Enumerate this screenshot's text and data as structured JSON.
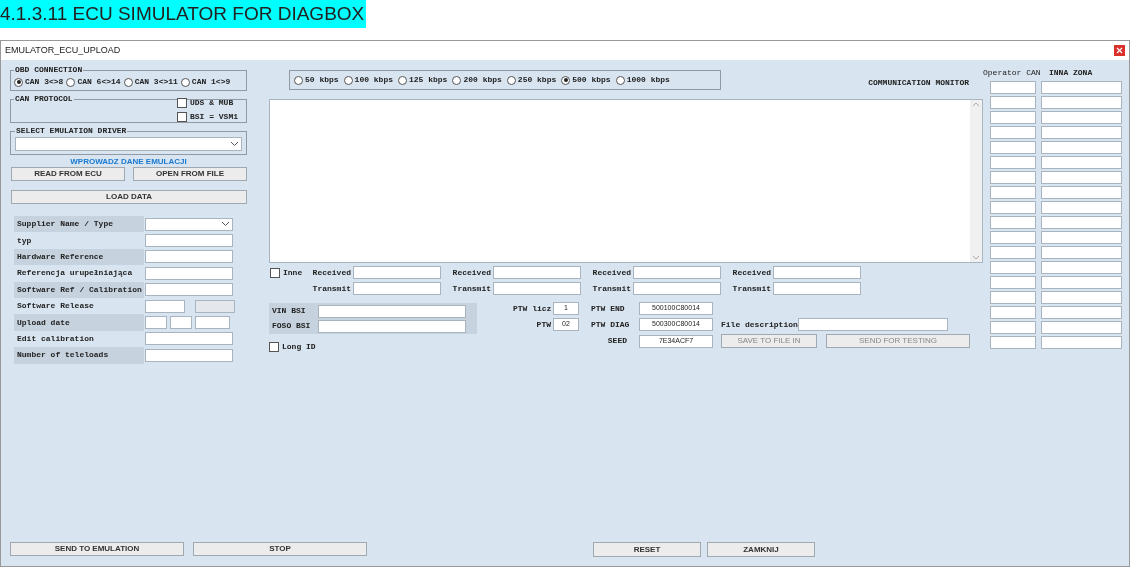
{
  "heading": "4.1.3.11 ECU SIMULATOR FOR DIAGBOX",
  "window": {
    "title": "EMULATOR_ECU_UPLOAD"
  },
  "obd_connection": {
    "legend": "OBD CONNECTION",
    "options": [
      {
        "label": "CAN 3<>8",
        "selected": true
      },
      {
        "label": "CAN 6<>14",
        "selected": false
      },
      {
        "label": "CAN 3<>11",
        "selected": false
      },
      {
        "label": "CAN 1<>9",
        "selected": false
      }
    ]
  },
  "can_protocol": {
    "legend": "CAN PROTOCOL",
    "options": [
      {
        "label": "UDS & MUB",
        "checked": false
      },
      {
        "label": "BSI = VSM1",
        "checked": false
      }
    ]
  },
  "emulation_driver": {
    "legend": "SELECT EMULATION DRIVER"
  },
  "section_title": "WPROWADZ DANE EMULACJI",
  "source_buttons": [
    "READ FROM ECU",
    "OPEN FROM FILE"
  ],
  "load_button": "LOAD DATA",
  "form": [
    {
      "label": "Supplier Name / Type",
      "kind": "select"
    },
    {
      "label": "typ",
      "kind": "text"
    },
    {
      "label": "Hardware Reference",
      "kind": "text"
    },
    {
      "label": "Referencja urupełniająca",
      "kind": "text"
    },
    {
      "label": "Software Ref / Calibration",
      "kind": "text"
    },
    {
      "label": "Software Release",
      "kind": "pair"
    },
    {
      "label": "Upload date",
      "kind": "date"
    },
    {
      "label": "Edit calibration",
      "kind": "text"
    },
    {
      "label": "Number of teleloads",
      "kind": "text"
    }
  ],
  "baud_rates": [
    {
      "label": "50 kbps",
      "selected": false
    },
    {
      "label": "100 kbps",
      "selected": false
    },
    {
      "label": "125 kbps",
      "selected": false
    },
    {
      "label": "200 kbps",
      "selected": false
    },
    {
      "label": "250 kbps",
      "selected": false
    },
    {
      "label": "500 kbps",
      "selected": true
    },
    {
      "label": "1000 kbps",
      "selected": false
    }
  ],
  "monitor": {
    "title": "COMMUNICATION MONITOR"
  },
  "inne": {
    "label": "Inne",
    "checked": false
  },
  "channels": [
    {
      "received": "Received",
      "transmit": "Transmit"
    },
    {
      "received": "Received",
      "transmit": "Transmit"
    },
    {
      "received": "Received",
      "transmit": "Transmit"
    },
    {
      "received": "Received",
      "transmit": "Transmit"
    }
  ],
  "bsi": [
    {
      "label": "VIN BSI"
    },
    {
      "label": "FOSO BSI"
    }
  ],
  "long_id": {
    "label": "Long ID",
    "checked": false
  },
  "ptw": [
    {
      "label": "PTW licz",
      "value": "1"
    },
    {
      "label": "PTW",
      "value": "02"
    }
  ],
  "ptw_codes": [
    {
      "label": "PTW END",
      "value": "500100C80014"
    },
    {
      "label": "PTW DIAG",
      "value": "500300C80014"
    }
  ],
  "seed": {
    "label": "SEED",
    "value": "7E34ACF7"
  },
  "file_description": {
    "label": "File description"
  },
  "file_buttons": [
    {
      "label": "SAVE TO FILE IN",
      "disabled": true
    },
    {
      "label": "SEND FOR TESTING",
      "disabled": true
    }
  ],
  "operator_can": {
    "title": "Operator CAN"
  },
  "inna_zona": {
    "title": "INNA ZONA"
  },
  "bottom_left_buttons": [
    "SEND TO EMULATION",
    "STOP"
  ],
  "reset_button": "RESET",
  "close_button": "ZAMKNIJ"
}
